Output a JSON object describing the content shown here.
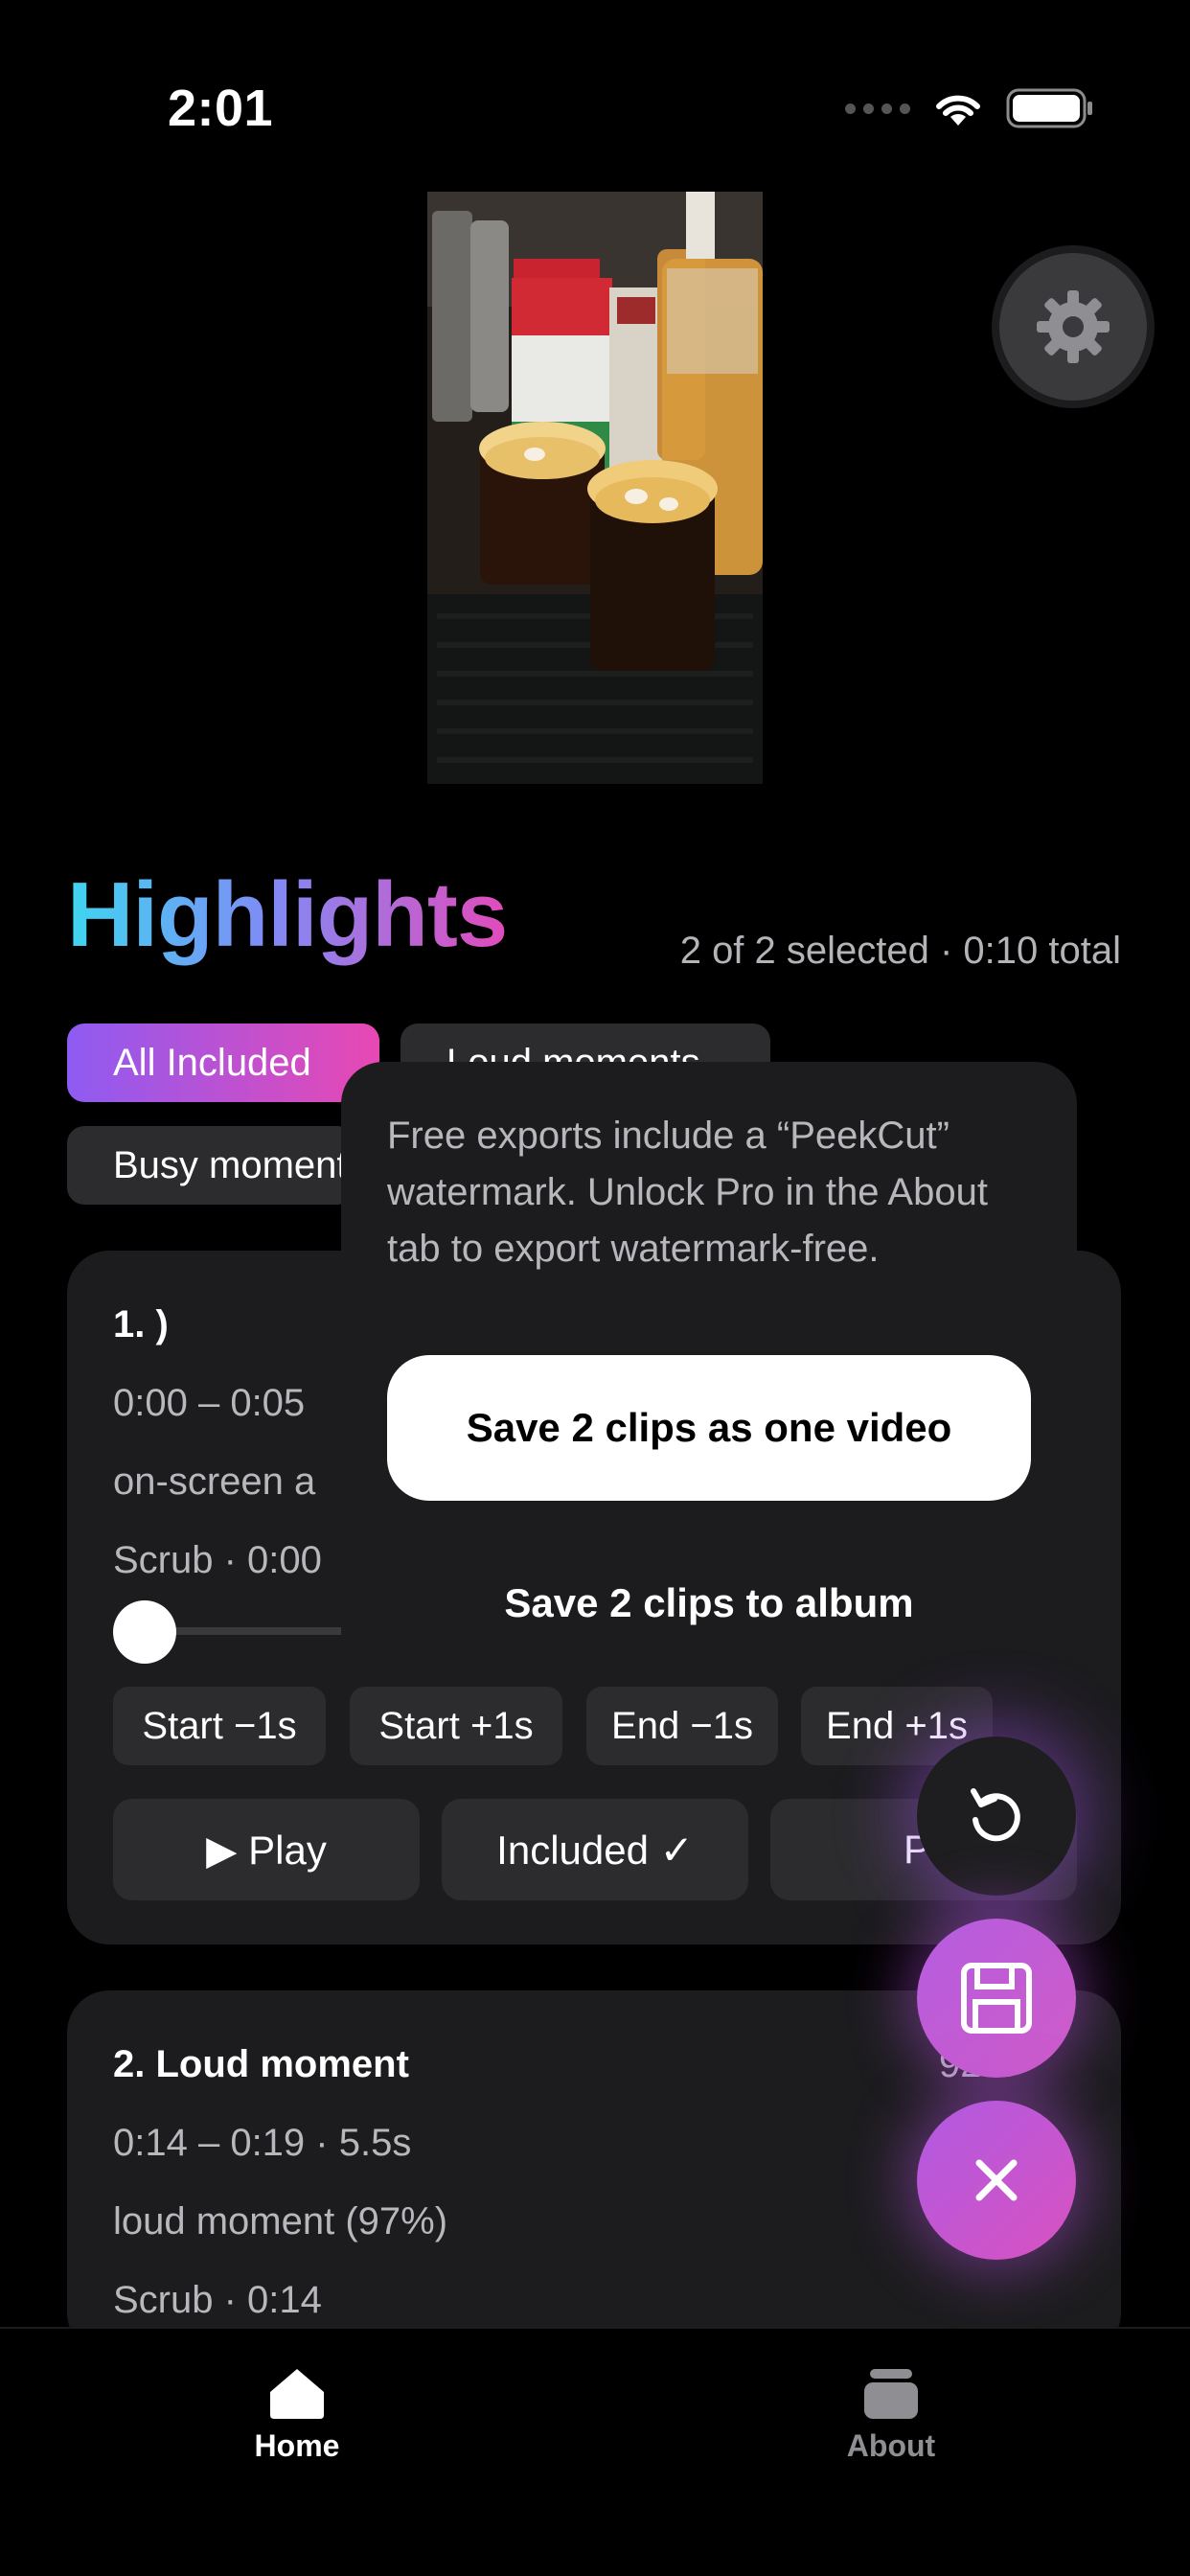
{
  "status_bar": {
    "time": "2:01"
  },
  "header": {
    "title": "Highlights",
    "summary": "2 of 2 selected · 0:10 total"
  },
  "filters": [
    {
      "label": "All Included",
      "active": true
    },
    {
      "label": "Loud moments",
      "active": false
    },
    {
      "label": "Busy moments",
      "active": false
    }
  ],
  "clips": [
    {
      "title": "1. )",
      "time_range": "0:00 – 0:05",
      "reason": "on-screen a",
      "scrub": "Scrub · 0:00",
      "progress": 0,
      "trim_buttons": [
        "Start −1s",
        "Start +1s",
        "End −1s",
        "End +1s"
      ],
      "actions": {
        "play": "▶ Play",
        "included": "Included ✓",
        "preview": "Pr"
      }
    },
    {
      "title": "2. Loud moment",
      "score": "92%",
      "time_range": "0:14 – 0:19 · 5.5s",
      "reason": "loud moment (97%)",
      "scrub": "Scrub · 0:14"
    }
  ],
  "export_popover": {
    "message": "Free exports include a “PeekCut” watermark. Unlock Pro in the About tab to export watermark-free.",
    "primary_action": "Save 2 clips as one video",
    "secondary_action": "Save 2 clips to album"
  },
  "fabs": {
    "reset_icon": "rotate-ccw-icon",
    "save_icon": "floppy-disk-icon",
    "close_icon": "close-icon"
  },
  "tabbar": {
    "home_label": "Home",
    "about_label": "About"
  },
  "colors": {
    "accent_gradient_start": "#8e5bf2",
    "accent_gradient_end": "#e848b3",
    "card_bg": "#1c1c1e",
    "button_bg": "#2c2c2e"
  }
}
